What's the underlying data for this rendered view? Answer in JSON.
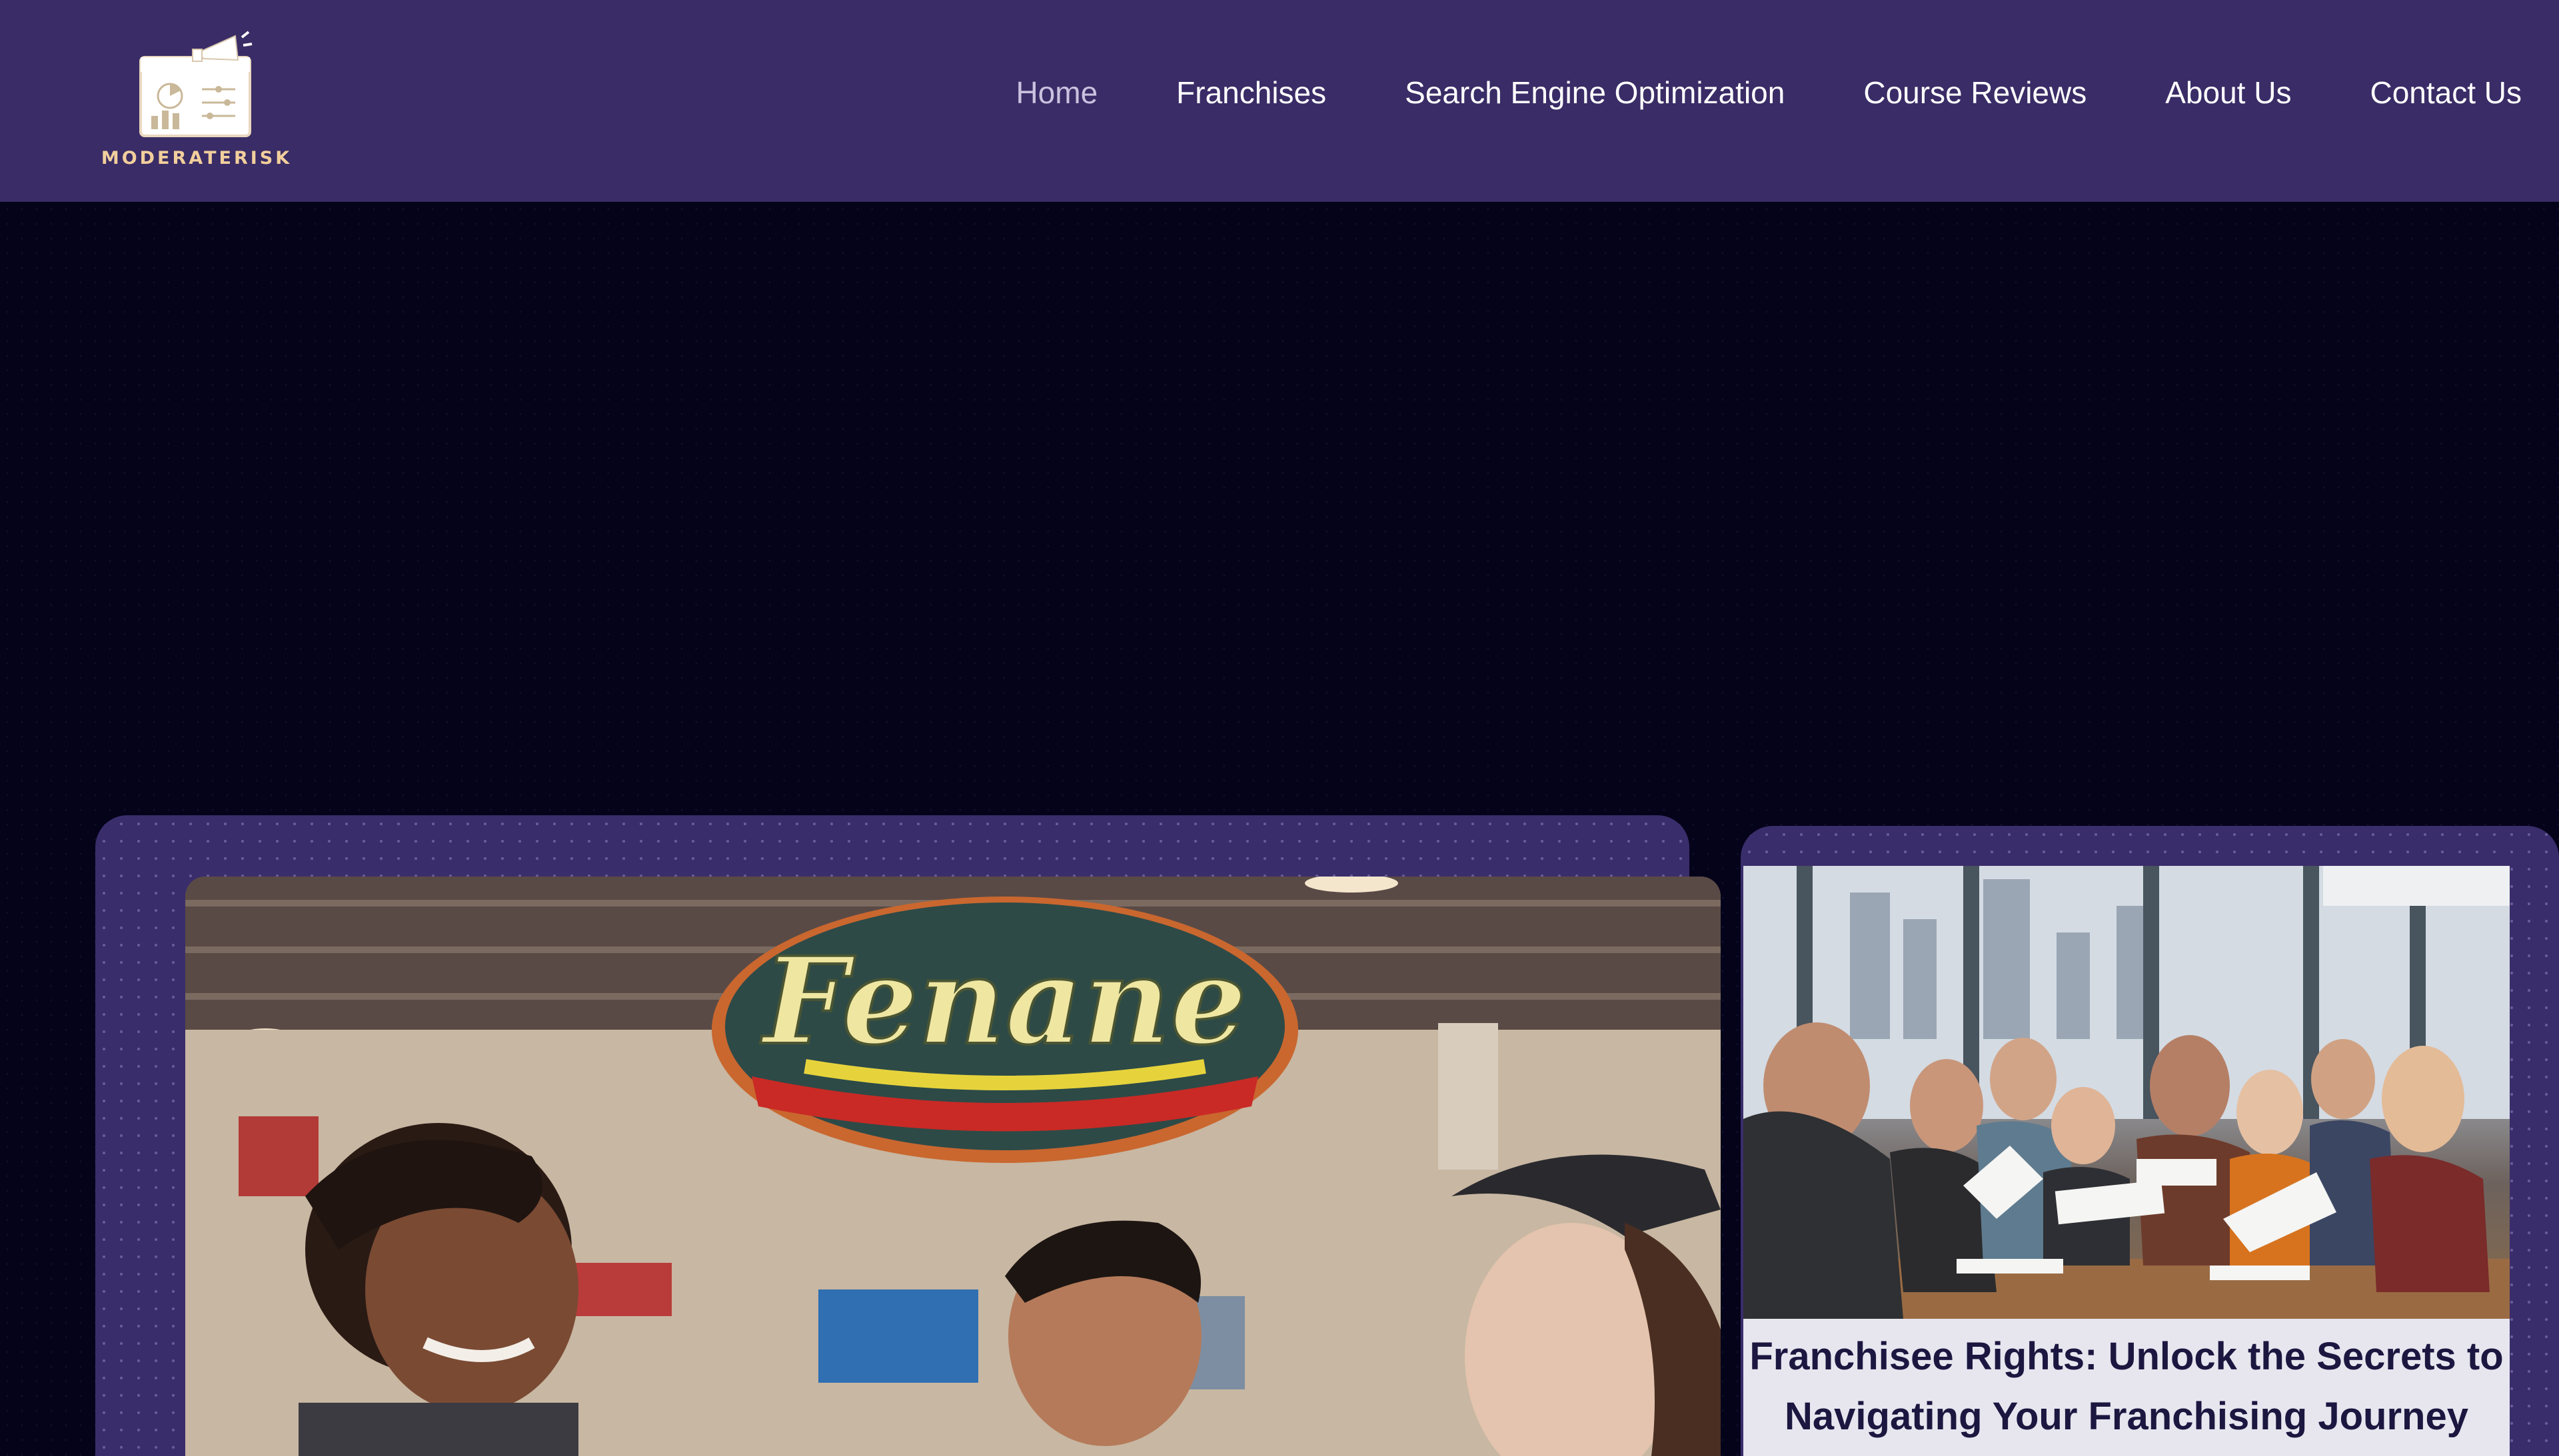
{
  "header": {
    "logo_text": "MODERATERISK",
    "nav": [
      {
        "label": "Home",
        "active": true
      },
      {
        "label": "Franchises",
        "active": false
      },
      {
        "label": "Search Engine Optimization",
        "active": false
      },
      {
        "label": "Course Reviews",
        "active": false
      },
      {
        "label": "About Us",
        "active": false
      },
      {
        "label": "Contact Us",
        "active": false
      }
    ]
  },
  "featured": {
    "sign_text": "Fenane"
  },
  "side_article": {
    "title": "Franchisee Rights: Unlock the Secrets to Navigating Your Franchising Journey"
  },
  "colors": {
    "header_bg": "#3a2c66",
    "page_bg": "#04031a",
    "card_bg": "#3a2d6b",
    "logo_text": "#f2cf9c",
    "nav_active": "#c9c2df",
    "nav_text": "#ffffff"
  }
}
